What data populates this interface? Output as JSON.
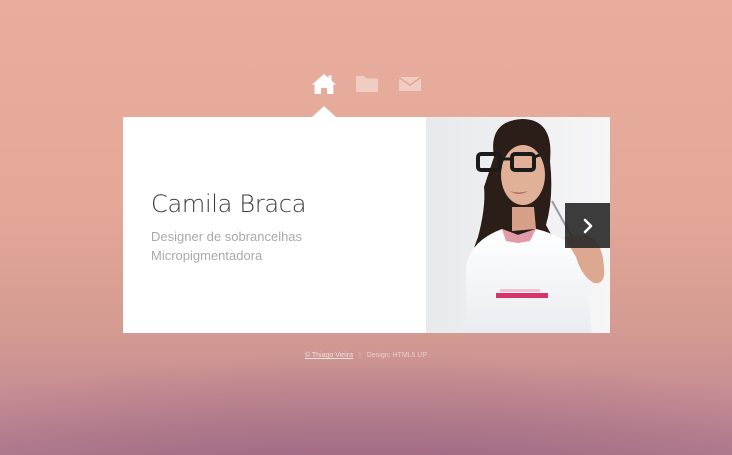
{
  "nav": {
    "items": [
      {
        "icon": "home-icon",
        "active": true
      },
      {
        "icon": "folder-icon",
        "active": false
      },
      {
        "icon": "envelope-icon",
        "active": false
      }
    ]
  },
  "profile": {
    "name": "Camila Braca",
    "roles": [
      "Designer de sobrancelhas",
      "Micropigmentadora"
    ]
  },
  "footer": {
    "credit": "© Thiago Vieira",
    "separator": "|",
    "design": "Design: HTML5 UP"
  },
  "colors": {
    "background_top": "#e9ad9d",
    "background_bottom": "#b98293",
    "card": "#ffffff",
    "name_text": "#3a3a3a",
    "role_text": "#a9a9a9",
    "nav_active": "#ffffff",
    "next_button": "#282828"
  }
}
